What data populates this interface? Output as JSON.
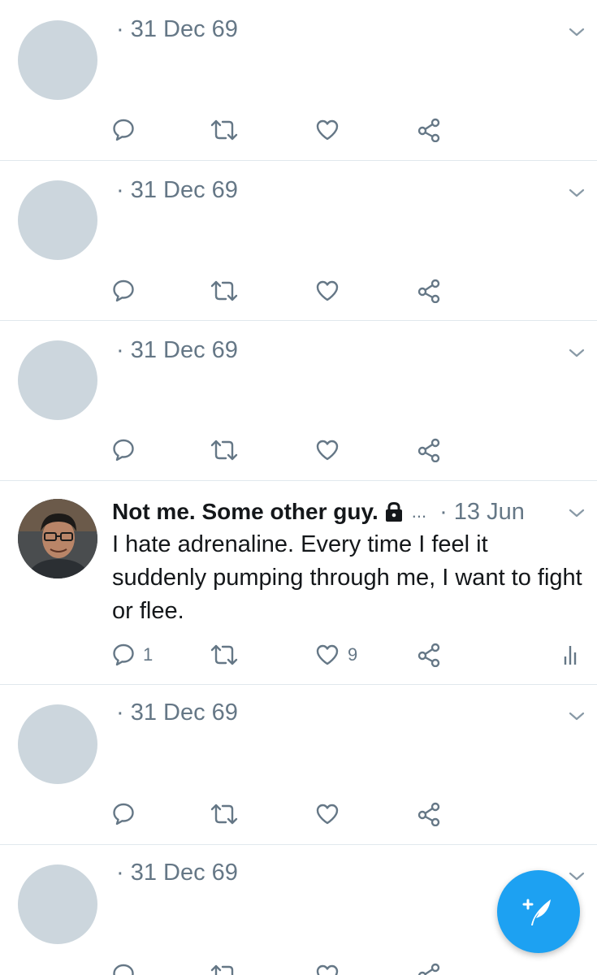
{
  "timeline": {
    "tweets": [
      {
        "date": "· 31 Dec 69"
      },
      {
        "date": "· 31 Dec 69"
      },
      {
        "date": "· 31 Dec 69"
      },
      {
        "name": "Not me. Some other guy.",
        "ellipsis": "...",
        "time": "· 13 Jun",
        "text": "I hate adrenaline. Every time I feel it suddenly pumping through me, I want to fight or flee.",
        "reply_count": "1",
        "like_count": "9"
      },
      {
        "date": "· 31 Dec 69"
      },
      {
        "date": "· 31 Dec 69"
      }
    ]
  },
  "icons": {
    "reply": "reply-icon",
    "retweet": "retweet-icon",
    "like": "heart-icon",
    "share": "share-icon",
    "analytics": "analytics-icon",
    "caret": "chevron-down-icon",
    "locked": "lock-icon",
    "compose": "compose-tweet-icon"
  },
  "colors": {
    "accent": "#1da1f2",
    "icon_gray": "#657786",
    "placeholder_avatar": "#ccd6dd",
    "divider": "#e1e8ed"
  }
}
